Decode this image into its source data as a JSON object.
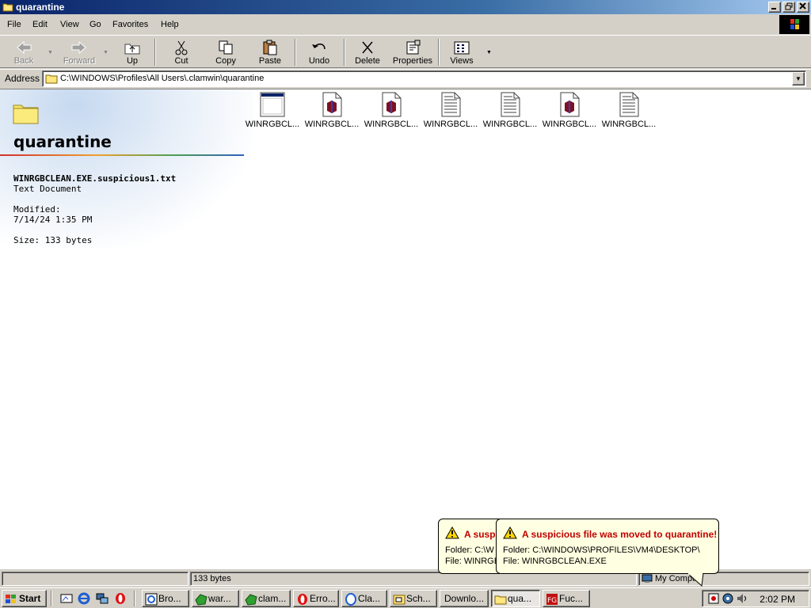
{
  "window": {
    "title": "quarantine"
  },
  "menu": [
    {
      "label": "File"
    },
    {
      "label": "Edit"
    },
    {
      "label": "View"
    },
    {
      "label": "Go"
    },
    {
      "label": "Favorites"
    },
    {
      "label": "Help"
    }
  ],
  "toolbar": {
    "back": "Back",
    "forward": "Forward",
    "up": "Up",
    "cut": "Cut",
    "copy": "Copy",
    "paste": "Paste",
    "undo": "Undo",
    "delete": "Delete",
    "properties": "Properties",
    "views": "Views"
  },
  "address": {
    "label": "Address",
    "value": "C:\\WINDOWS\\Profiles\\All Users\\.clamwin\\quarantine"
  },
  "webview": {
    "folder_title": "quarantine",
    "selected_name": "WINRGBCLEAN.EXE.suspicious1.txt",
    "selected_type": "Text Document",
    "modified_label": "Modified:",
    "modified_value": "7/14/24 1:35 PM",
    "size_text": "Size: 133 bytes"
  },
  "files": [
    {
      "label": "WINRGBCL...",
      "icon": "window-app-icon"
    },
    {
      "label": "WINRGBCL...",
      "icon": "exe-file-icon"
    },
    {
      "label": "WINRGBCL...",
      "icon": "exe-file-icon"
    },
    {
      "label": "WINRGBCL...",
      "icon": "text-document-icon"
    },
    {
      "label": "WINRGBCL...",
      "icon": "text-document-icon"
    },
    {
      "label": "WINRGBCL...",
      "icon": "exe-file-icon"
    },
    {
      "label": "WINRGBCL...",
      "icon": "text-document-icon"
    }
  ],
  "status": {
    "size": "133 bytes",
    "zone": "My Compu"
  },
  "balloon_back": {
    "title": "A suspi",
    "folder": "Folder: C:\\W",
    "file": "File: WINRGB"
  },
  "balloon_front": {
    "title": "A suspicious file was moved to quarantine!",
    "folder": "Folder: C:\\WINDOWS\\PROFILES\\VM4\\DESKTOP\\",
    "file": "File: WINRGBCLEAN.EXE"
  },
  "taskbar": {
    "start": "Start",
    "tasks": [
      {
        "label": "Bro...",
        "icon": "browser-icon"
      },
      {
        "label": "war...",
        "icon": "clamwin-icon"
      },
      {
        "label": "clam...",
        "icon": "clamwin-icon"
      },
      {
        "label": "Erro...",
        "icon": "opera-icon"
      },
      {
        "label": "Cla...",
        "icon": "ie-page-icon"
      },
      {
        "label": "Sch...",
        "icon": "scheduler-icon"
      },
      {
        "label": "Downlo...",
        "icon": ""
      },
      {
        "label": "qua...",
        "icon": "folder-icon"
      },
      {
        "label": "Fuc...",
        "icon": "fg-app-icon"
      }
    ],
    "clock": "2:02 PM"
  },
  "colors": {
    "titlebar": "#0a246a",
    "face": "#d4d0c8",
    "balloon_bg": "#ffffe1",
    "balloon_title": "#c00000"
  }
}
